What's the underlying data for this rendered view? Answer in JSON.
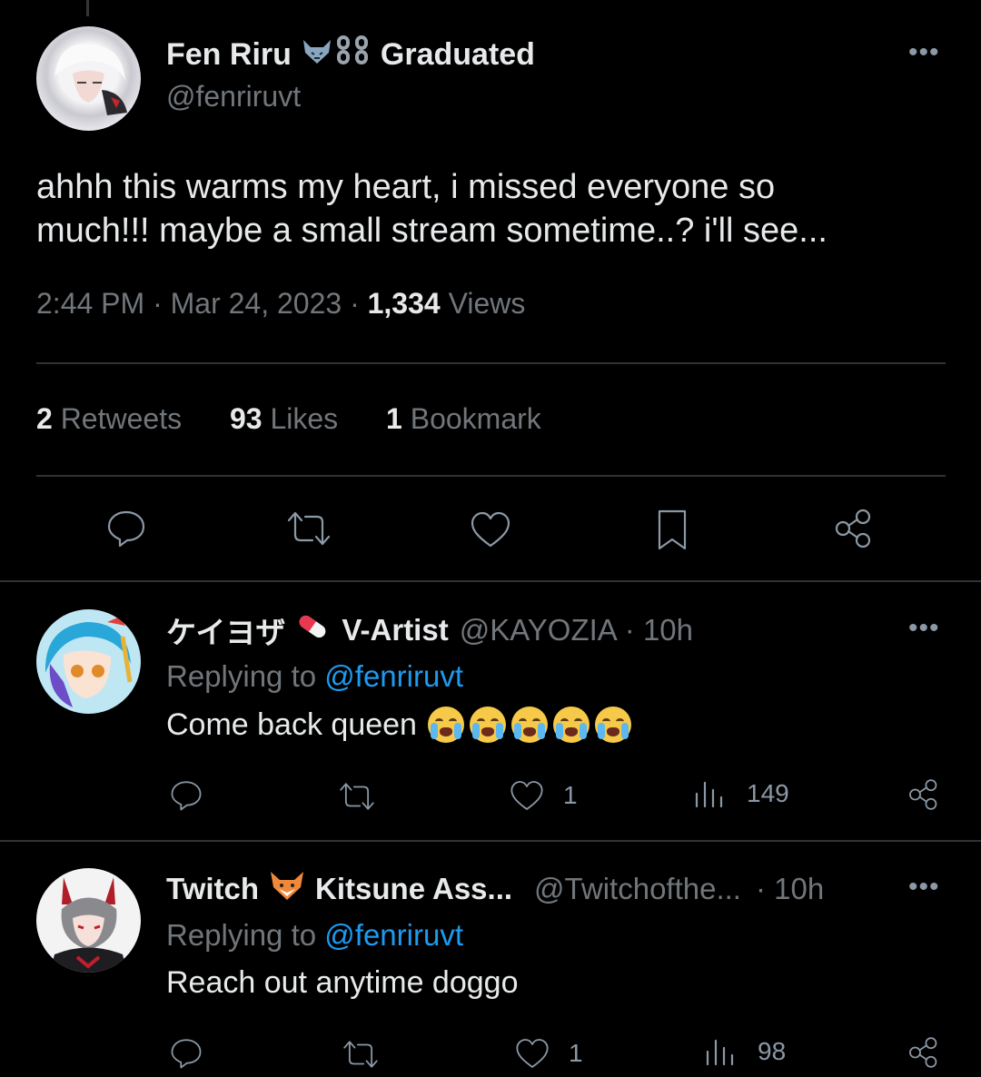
{
  "main_tweet": {
    "display_name": "Fen Riru",
    "badge_text": "Graduated",
    "handle": "@fenriruvt",
    "text_line1": "ahhh this warms my heart, i missed everyone so",
    "text_line2": "much!!! maybe a small stream sometime..? i'll see...",
    "time": "2:44 PM",
    "sep": "·",
    "date": "Mar 24, 2023",
    "views_count": "1,334",
    "views_label": "Views",
    "retweets_count": "2",
    "retweets_label": "Retweets",
    "likes_count": "93",
    "likes_label": "Likes",
    "bookmarks_count": "1",
    "bookmarks_label": "Bookmark"
  },
  "replies": [
    {
      "name_jp": "ケイヨザ",
      "name_rest": "V-Artist",
      "handle": "@KAYOZIA",
      "time": "· 10h",
      "replying_prefix": "Replying to",
      "replying_handle": "@fenriruvt",
      "text": "Come back queen",
      "likes": "1",
      "views": "149"
    },
    {
      "name_first": "Twitch",
      "name_rest": "Kitsune Ass...",
      "handle": "@Twitchofthe...",
      "time": "· 10h",
      "replying_prefix": "Replying to",
      "replying_handle": "@fenriruvt",
      "text": "Reach out anytime doggo",
      "likes": "1",
      "views": "98"
    }
  ],
  "colors": {
    "background": "#000000",
    "text": "#e7e9ea",
    "muted": "#71767b",
    "link": "#1d9bf0",
    "divider": "#2f3336"
  },
  "icons": [
    "wolf-emoji-icon",
    "chain-emoji-icon",
    "pill-emoji-icon",
    "fox-emoji-icon",
    "loudly-crying-face-emoji-icon",
    "reply-icon",
    "retweet-icon",
    "like-icon",
    "bookmark-icon",
    "share-icon",
    "views-icon",
    "more-icon"
  ]
}
